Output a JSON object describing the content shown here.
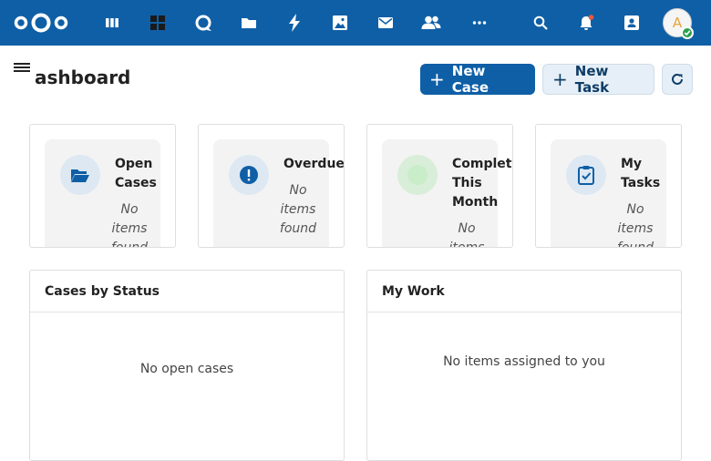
{
  "topbar": {
    "bg_color": "#0f5fa6",
    "logo": "nextcloud-logo",
    "apps": [
      {
        "name": "dashboard-apps-icon"
      },
      {
        "name": "tiles-icon"
      },
      {
        "name": "talk-icon"
      },
      {
        "name": "files-icon"
      },
      {
        "name": "activity-icon"
      },
      {
        "name": "photos-icon"
      },
      {
        "name": "mail-icon"
      },
      {
        "name": "contacts-icon"
      },
      {
        "name": "more-apps-icon"
      }
    ],
    "right_icons": [
      {
        "name": "search-icon"
      },
      {
        "name": "notifications-icon"
      },
      {
        "name": "contacts-menu-icon"
      }
    ],
    "avatar_letter": "A"
  },
  "header": {
    "title": "ashboard",
    "new_case_label": "New Case",
    "new_task_label": "New Task",
    "plus": "+"
  },
  "stats": [
    {
      "label": "Open Cases",
      "empty": "No items found",
      "icon": "folder-open-icon"
    },
    {
      "label": "Overdue",
      "empty": "No items found",
      "icon": "alert-circle-icon"
    },
    {
      "label": "Completed This Month",
      "empty": "No items",
      "icon": "check-circle-icon"
    },
    {
      "label": "My Tasks",
      "empty": "No items found",
      "icon": "clipboard-check-icon"
    }
  ],
  "panels": {
    "cases_by_status": {
      "title": "Cases by Status",
      "empty": "No open cases"
    },
    "my_work": {
      "title": "My Work",
      "empty": "No items assigned to you"
    }
  }
}
